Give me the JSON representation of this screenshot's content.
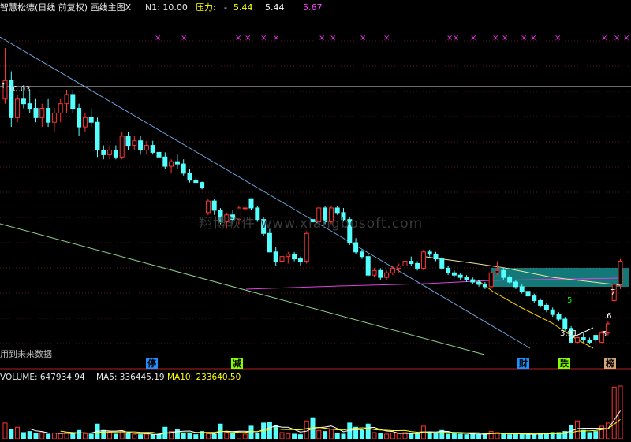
{
  "header": {
    "title": "智慧松德(日线 前复权) 画线主图X",
    "n1_label": "N1: 10.00",
    "pressure_label": "压力:",
    "pressure_dash": "-",
    "pressure_v1": "5.44",
    "pressure_v2": "5.44",
    "pressure_v3": "5.67"
  },
  "price_marker": "10.03",
  "future_data_note": "用到未来数据",
  "watermark": "翔博软件 www.xiangbosoft.com",
  "badges": [
    {
      "id": "ting",
      "text": "停",
      "color": "#1e90ff"
    },
    {
      "id": "jian",
      "text": "减",
      "color": "#7fff00"
    },
    {
      "id": "cai",
      "text": "财",
      "color": "#1e90ff"
    },
    {
      "id": "die",
      "text": "跌",
      "color": "#7fff00"
    },
    {
      "id": "bang",
      "text": "榜",
      "color": "#d2a679"
    }
  ],
  "annotations": [
    {
      "id": "a5g",
      "text": "5",
      "color": "#00ff00"
    },
    {
      "id": "a7",
      "text": "7",
      "color": "#ffffff"
    },
    {
      "id": "a6",
      "text": ".6",
      "color": "#ffffff"
    },
    {
      "id": "a5w",
      "text": "5",
      "color": "#ffffff"
    },
    {
      "id": "low",
      "text": "3.91",
      "color": "#ffffff"
    }
  ],
  "volume_header": {
    "volume": "VOLUME: 647934.94",
    "ma5": "MA5: 336445.19",
    "ma10": "MA10: 233640.50"
  },
  "colors": {
    "up": "#ff3333",
    "down": "#54ffff",
    "marker": "#ff33ff",
    "pressure": "#ffff00",
    "ma5": "#ffffff",
    "ma10": "#ffff00"
  },
  "chart_data": {
    "type": "candlestick",
    "candles": [
      [
        9.2,
        10.3,
        9.1,
        9.6
      ],
      [
        9.6,
        9.8,
        8.6,
        8.8
      ],
      [
        8.8,
        9.3,
        8.7,
        9.2
      ],
      [
        9.2,
        9.5,
        9.0,
        9.1
      ],
      [
        9.1,
        9.4,
        8.9,
        9.0
      ],
      [
        9.0,
        9.2,
        8.7,
        8.8
      ],
      [
        8.8,
        9.1,
        8.6,
        9.0
      ],
      [
        9.0,
        9.2,
        8.6,
        8.7
      ],
      [
        8.7,
        9.0,
        8.5,
        8.9
      ],
      [
        8.9,
        9.2,
        8.7,
        9.1
      ],
      [
        9.1,
        9.4,
        8.9,
        9.3
      ],
      [
        9.3,
        9.4,
        8.9,
        9.0
      ],
      [
        9.0,
        9.1,
        8.4,
        8.6
      ],
      [
        8.6,
        8.9,
        8.5,
        8.8
      ],
      [
        8.8,
        9.0,
        8.6,
        8.7
      ],
      [
        8.7,
        8.8,
        7.95,
        8.1
      ],
      [
        8.1,
        8.2,
        7.9,
        8.0
      ],
      [
        8.0,
        8.2,
        7.9,
        8.1
      ],
      [
        8.1,
        8.2,
        7.9,
        7.95
      ],
      [
        7.95,
        8.5,
        7.9,
        8.4
      ],
      [
        8.4,
        8.5,
        8.1,
        8.2
      ],
      [
        8.2,
        8.4,
        8.1,
        8.3
      ],
      [
        8.3,
        8.4,
        8.0,
        8.1
      ],
      [
        8.1,
        8.3,
        8.0,
        8.2
      ],
      [
        8.2,
        8.3,
        8.0,
        8.05
      ],
      [
        8.05,
        8.1,
        7.9,
        7.95
      ],
      [
        7.95,
        8.05,
        7.7,
        7.75
      ],
      [
        7.75,
        7.9,
        7.6,
        7.85
      ],
      [
        7.85,
        8.0,
        7.7,
        7.8
      ],
      [
        7.8,
        7.9,
        7.55,
        7.6
      ],
      [
        7.6,
        7.7,
        7.4,
        7.45
      ],
      [
        7.45,
        7.5,
        7.4,
        7.4
      ],
      [
        7.4,
        7.42,
        7.25,
        7.3
      ],
      [
        6.75,
        7.05,
        6.7,
        7.0
      ],
      [
        7.0,
        7.05,
        6.7,
        6.8
      ],
      [
        6.8,
        6.85,
        6.5,
        6.55
      ],
      [
        6.55,
        6.75,
        6.4,
        6.7
      ],
      [
        6.7,
        6.8,
        6.5,
        6.6
      ],
      [
        6.6,
        6.9,
        6.5,
        6.85
      ],
      [
        6.85,
        6.9,
        6.8,
        6.85
      ],
      [
        7.05,
        7.05,
        6.8,
        6.85
      ],
      [
        6.85,
        6.9,
        6.55,
        6.6
      ],
      [
        6.6,
        6.65,
        6.25,
        6.3
      ],
      [
        6.3,
        6.4,
        5.9,
        5.9
      ],
      [
        5.9,
        6.0,
        5.6,
        5.7
      ],
      [
        5.7,
        5.85,
        5.6,
        5.8
      ],
      [
        5.8,
        5.9,
        5.65,
        5.85
      ],
      [
        5.85,
        5.9,
        5.7,
        5.75
      ],
      [
        5.75,
        5.8,
        5.6,
        5.7
      ],
      [
        5.7,
        6.35,
        5.65,
        6.3
      ],
      [
        6.6,
        6.6,
        6.55,
        6.55
      ],
      [
        6.55,
        6.9,
        6.5,
        6.85
      ],
      [
        6.85,
        6.9,
        6.5,
        6.55
      ],
      [
        6.55,
        6.9,
        6.5,
        6.85
      ],
      [
        6.85,
        6.9,
        6.7,
        6.75
      ],
      [
        6.75,
        6.85,
        6.55,
        6.6
      ],
      [
        6.6,
        6.65,
        6.05,
        6.1
      ],
      [
        6.1,
        6.2,
        5.85,
        5.9
      ],
      [
        5.9,
        5.95,
        5.75,
        5.8
      ],
      [
        5.8,
        5.85,
        5.35,
        5.4
      ],
      [
        5.4,
        5.55,
        5.35,
        5.5
      ],
      [
        5.5,
        5.55,
        5.3,
        5.35
      ],
      [
        5.35,
        5.5,
        5.3,
        5.45
      ],
      [
        5.45,
        5.6,
        5.4,
        5.55
      ],
      [
        5.55,
        5.65,
        5.45,
        5.6
      ],
      [
        5.6,
        5.75,
        5.5,
        5.7
      ],
      [
        5.7,
        5.8,
        5.6,
        5.65
      ],
      [
        5.65,
        5.7,
        5.5,
        5.55
      ],
      [
        5.55,
        5.95,
        5.5,
        5.9
      ],
      [
        5.9,
        5.95,
        5.8,
        5.85
      ],
      [
        5.85,
        5.9,
        5.7,
        5.75
      ],
      [
        5.75,
        5.8,
        5.5,
        5.55
      ],
      [
        5.55,
        5.6,
        5.4,
        5.45
      ],
      [
        5.45,
        5.5,
        5.35,
        5.4
      ],
      [
        5.4,
        5.45,
        5.3,
        5.35
      ],
      [
        5.35,
        5.4,
        5.25,
        5.3
      ],
      [
        5.3,
        5.35,
        5.2,
        5.25
      ],
      [
        5.25,
        5.3,
        5.15,
        5.2
      ],
      [
        5.2,
        5.25,
        5.1,
        5.15
      ],
      [
        5.15,
        5.5,
        5.1,
        5.45
      ],
      [
        5.45,
        5.7,
        5.4,
        5.5
      ],
      [
        5.5,
        5.55,
        5.3,
        5.35
      ],
      [
        5.35,
        5.4,
        5.2,
        5.25
      ],
      [
        5.25,
        5.3,
        5.1,
        5.15
      ],
      [
        5.15,
        5.2,
        5.0,
        5.05
      ],
      [
        5.05,
        5.1,
        4.9,
        4.95
      ],
      [
        4.95,
        5.0,
        4.8,
        4.85
      ],
      [
        4.85,
        4.9,
        4.7,
        4.75
      ],
      [
        4.75,
        4.8,
        4.6,
        4.65
      ],
      [
        4.65,
        4.7,
        4.5,
        4.55
      ],
      [
        4.55,
        4.6,
        4.4,
        4.45
      ],
      [
        4.45,
        4.5,
        4.2,
        4.25
      ],
      [
        4.25,
        4.3,
        3.95,
        3.95
      ],
      [
        3.95,
        4.1,
        3.91,
        4.05
      ],
      [
        4.05,
        4.15,
        3.95,
        4.0
      ],
      [
        4.0,
        4.05,
        3.92,
        3.95
      ],
      [
        4.1,
        4.1,
        3.95,
        4.0
      ],
      [
        3.95,
        4.2,
        3.93,
        4.15
      ],
      [
        4.15,
        4.4,
        4.1,
        4.35
      ],
      [
        4.85,
        5.2,
        4.8,
        5.2
      ],
      [
        5.2,
        5.75,
        5.1,
        5.7
      ]
    ],
    "price_range": [
      3.6,
      11.0
    ],
    "volumes": [
      30,
      18,
      22,
      12,
      14,
      10,
      12,
      9,
      11,
      10,
      12,
      9,
      16,
      10,
      9,
      28,
      16,
      12,
      9,
      14,
      10,
      9,
      8,
      9,
      8,
      8,
      22,
      14,
      18,
      11,
      10,
      8,
      14,
      10,
      9,
      28,
      12,
      10,
      14,
      9,
      24,
      10,
      30,
      32,
      26,
      12,
      10,
      9,
      8,
      34,
      40,
      16,
      14,
      18,
      10,
      9,
      30,
      22,
      16,
      28,
      12,
      10,
      9,
      11,
      10,
      12,
      9,
      10,
      24,
      12,
      10,
      16,
      9,
      10,
      9,
      8,
      10,
      9,
      8,
      14,
      12,
      9,
      8,
      9,
      10,
      9,
      8,
      10,
      11,
      12,
      12,
      14,
      25,
      34,
      16,
      12,
      14,
      24,
      30,
      98,
      100
    ]
  }
}
